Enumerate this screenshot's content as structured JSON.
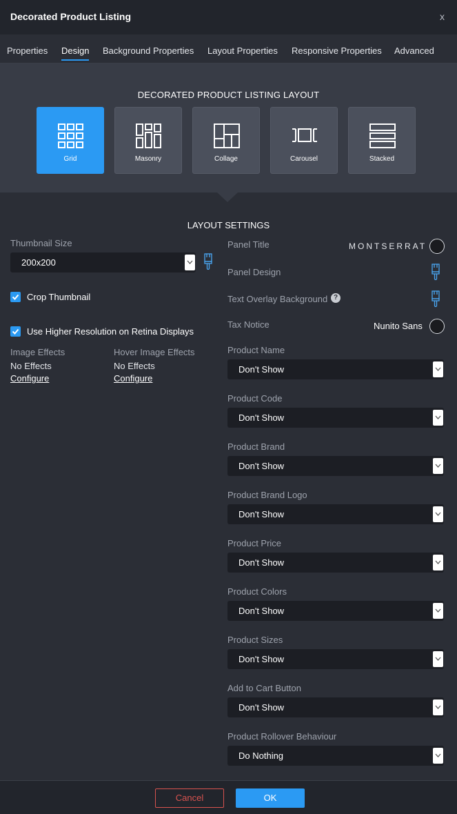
{
  "window": {
    "title": "Decorated Product Listing",
    "close_label": "x"
  },
  "tabs": [
    {
      "label": "Properties"
    },
    {
      "label": "Design"
    },
    {
      "label": "Background Properties"
    },
    {
      "label": "Layout Properties"
    },
    {
      "label": "Responsive Properties"
    },
    {
      "label": "Advanced"
    }
  ],
  "active_tab": "Design",
  "layout": {
    "caption": "DECORATED PRODUCT LISTING LAYOUT",
    "options": [
      {
        "label": "Grid",
        "icon": "grid-icon"
      },
      {
        "label": "Masonry",
        "icon": "masonry-icon"
      },
      {
        "label": "Collage",
        "icon": "collage-icon"
      },
      {
        "label": "Carousel",
        "icon": "carousel-icon"
      },
      {
        "label": "Stacked",
        "icon": "stacked-icon"
      }
    ],
    "selected": "Grid"
  },
  "settings": {
    "title": "LAYOUT SETTINGS",
    "thumbnail_size": {
      "label": "Thumbnail Size",
      "value": "200x200"
    },
    "crop_thumbnail": {
      "label": "Crop Thumbnail",
      "checked": true
    },
    "retina": {
      "label": "Use Higher Resolution on Retina Displays",
      "checked": true
    },
    "image_effects": {
      "label": "Image Effects",
      "value": "No Effects",
      "link": "Configure"
    },
    "hover_effects": {
      "label": "Hover Image Effects",
      "value": "No Effects",
      "link": "Configure"
    },
    "panel_title": {
      "label": "Panel Title",
      "font": "MONTSERRAT"
    },
    "panel_design": {
      "label": "Panel Design"
    },
    "text_overlay": {
      "label": "Text Overlay Background",
      "help": "?"
    },
    "tax_notice": {
      "label": "Tax Notice",
      "font": "Nunito Sans"
    },
    "fields": [
      {
        "label": "Product Name",
        "value": "Don't Show"
      },
      {
        "label": "Product Code",
        "value": "Don't Show"
      },
      {
        "label": "Product Brand",
        "value": "Don't Show"
      },
      {
        "label": "Product Brand Logo",
        "value": "Don't Show"
      },
      {
        "label": "Product Price",
        "value": "Don't Show"
      },
      {
        "label": "Product Colors",
        "value": "Don't Show"
      },
      {
        "label": "Product Sizes",
        "value": "Don't Show"
      },
      {
        "label": "Add to Cart Button",
        "value": "Don't Show"
      },
      {
        "label": "Product Rollover Behaviour",
        "value": "Do Nothing"
      }
    ]
  },
  "footer": {
    "cancel_label": "Cancel",
    "ok_label": "OK"
  },
  "colors": {
    "accent": "#2b9af3",
    "cancel": "#d9534f"
  }
}
